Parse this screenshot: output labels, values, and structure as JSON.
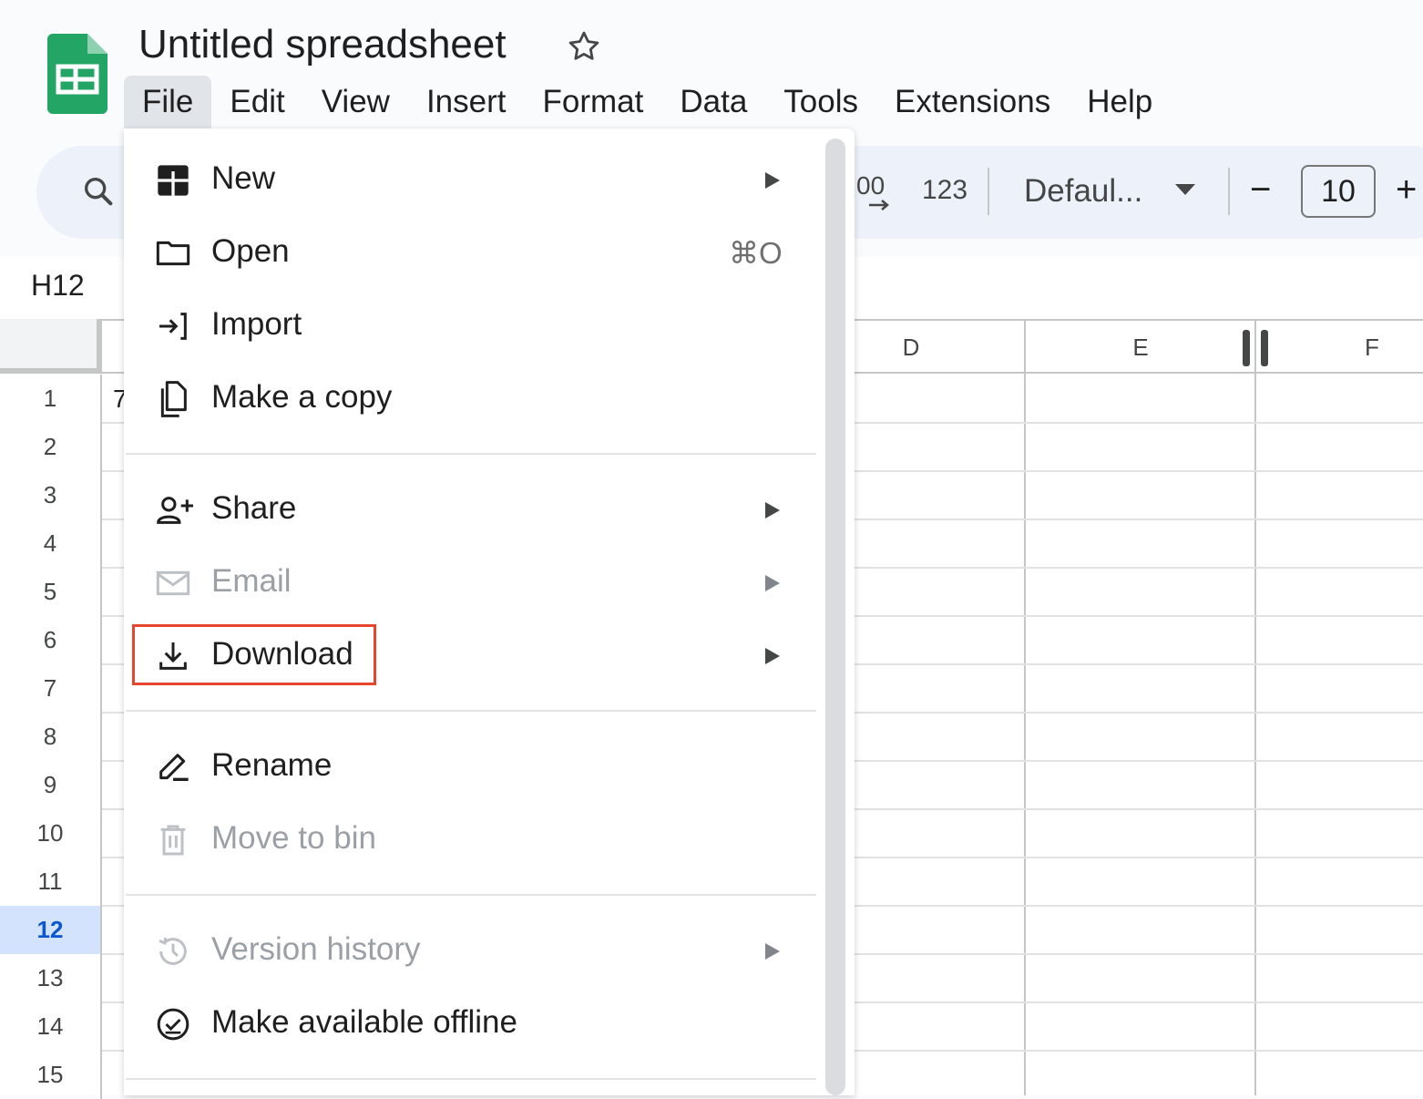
{
  "app": {
    "title": "Untitled spreadsheet",
    "brand_color": "#188038"
  },
  "menubar": {
    "items": [
      {
        "label": "File",
        "active": true
      },
      {
        "label": "Edit"
      },
      {
        "label": "View"
      },
      {
        "label": "Insert"
      },
      {
        "label": "Format"
      },
      {
        "label": "Data"
      },
      {
        "label": "Tools"
      },
      {
        "label": "Extensions"
      },
      {
        "label": "Help"
      }
    ]
  },
  "toolbar": {
    "decimal_label": "00",
    "number_format_label": "123",
    "font_name": "Defaul...",
    "font_size": "10",
    "decrease_label": "−",
    "increase_label": "+"
  },
  "namebox": {
    "value": "H12"
  },
  "grid": {
    "columns": [
      "D",
      "E",
      "F"
    ],
    "rows": [
      "1",
      "2",
      "3",
      "4",
      "5",
      "6",
      "7",
      "8",
      "9",
      "10",
      "11",
      "12",
      "13",
      "14",
      "15"
    ],
    "selected_row": "12",
    "cell_fragment": "7"
  },
  "file_menu": {
    "items": [
      {
        "label": "New",
        "icon": "new-sheet-icon",
        "submenu": true,
        "disabled": false
      },
      {
        "label": "Open",
        "icon": "folder-icon",
        "shortcut": "⌘O",
        "disabled": false
      },
      {
        "label": "Import",
        "icon": "import-icon",
        "disabled": false
      },
      {
        "label": "Make a copy",
        "icon": "copy-icon",
        "disabled": false
      },
      {
        "label": "Share",
        "icon": "share-person-icon",
        "submenu": true,
        "disabled": false
      },
      {
        "label": "Email",
        "icon": "email-icon",
        "submenu": true,
        "disabled": true
      },
      {
        "label": "Download",
        "icon": "download-icon",
        "submenu": true,
        "disabled": false,
        "highlighted": true
      },
      {
        "label": "Rename",
        "icon": "rename-icon",
        "disabled": false
      },
      {
        "label": "Move to bin",
        "icon": "trash-icon",
        "disabled": true
      },
      {
        "label": "Version history",
        "icon": "history-icon",
        "submenu": true,
        "disabled": true
      },
      {
        "label": "Make available offline",
        "icon": "offline-check-icon",
        "disabled": false
      }
    ],
    "highlight_color": "#e8452d"
  }
}
